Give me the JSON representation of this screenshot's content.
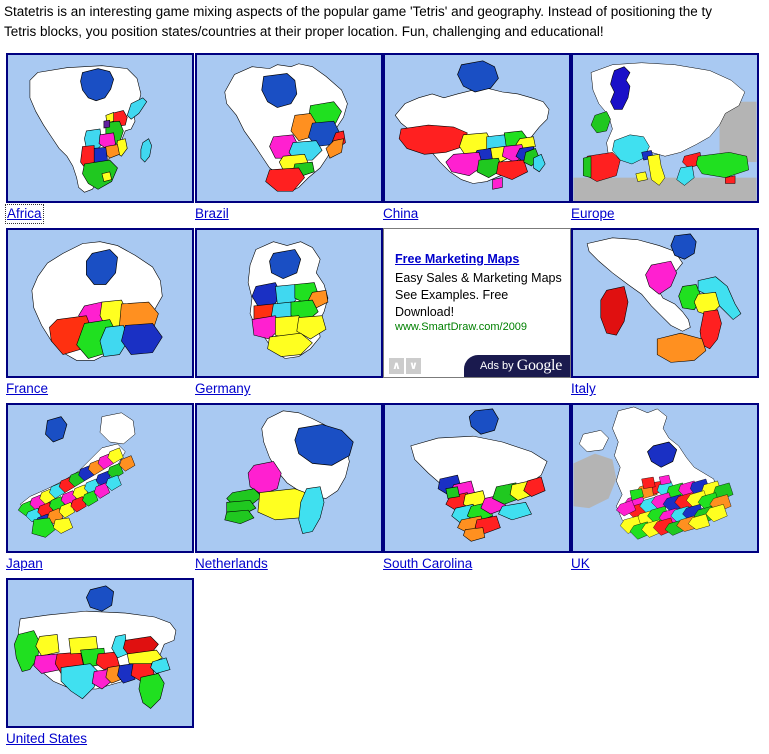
{
  "intro": {
    "line1": "Statetris is an interesting game mixing aspects of the popular game 'Tetris' and geography. Instead of positioning the ty",
    "line2": "Tetris blocks, you position states/countries at their proper location. Fun, challenging and educational!"
  },
  "colors": {
    "thumb_border": "#000080",
    "thumb_sea": "#a9c9f2",
    "link": "#0000cc",
    "ad_url": "#008000",
    "ad_bar": "#1a1a4e",
    "page_bg": "#ffffff"
  },
  "games": [
    {
      "label": "Africa",
      "icon": "map-africa-thumbnail",
      "focused": true
    },
    {
      "label": "Brazil",
      "icon": "map-brazil-thumbnail",
      "focused": false
    },
    {
      "label": "China",
      "icon": "map-china-thumbnail",
      "focused": false
    },
    {
      "label": "Europe",
      "icon": "map-europe-thumbnail",
      "focused": false
    },
    {
      "label": "France",
      "icon": "map-france-thumbnail",
      "focused": false
    },
    {
      "label": "Germany",
      "icon": "map-germany-thumbnail",
      "focused": false
    },
    {
      "label": "Italy",
      "icon": "map-italy-thumbnail",
      "focused": false
    },
    {
      "label": "Japan",
      "icon": "map-japan-thumbnail",
      "focused": false
    },
    {
      "label": "Netherlands",
      "icon": "map-netherlands-thumbnail",
      "focused": false
    },
    {
      "label": "South Carolina",
      "icon": "map-southcarolina-thumbnail",
      "focused": false
    },
    {
      "label": "UK",
      "icon": "map-uk-thumbnail",
      "focused": false
    },
    {
      "label": "United States",
      "icon": "map-unitedstates-thumbnail",
      "focused": false
    }
  ],
  "ad": {
    "title": "Free Marketing Maps",
    "line1": "Easy Sales & Marketing Maps",
    "line2": "See Examples. Free",
    "line3": "Download!",
    "url": "www.SmartDraw.com/2009",
    "prev_arrow": "∧",
    "next_arrow": "∨",
    "byline_prefix": "Ads by ",
    "byline_brand": "Google"
  }
}
